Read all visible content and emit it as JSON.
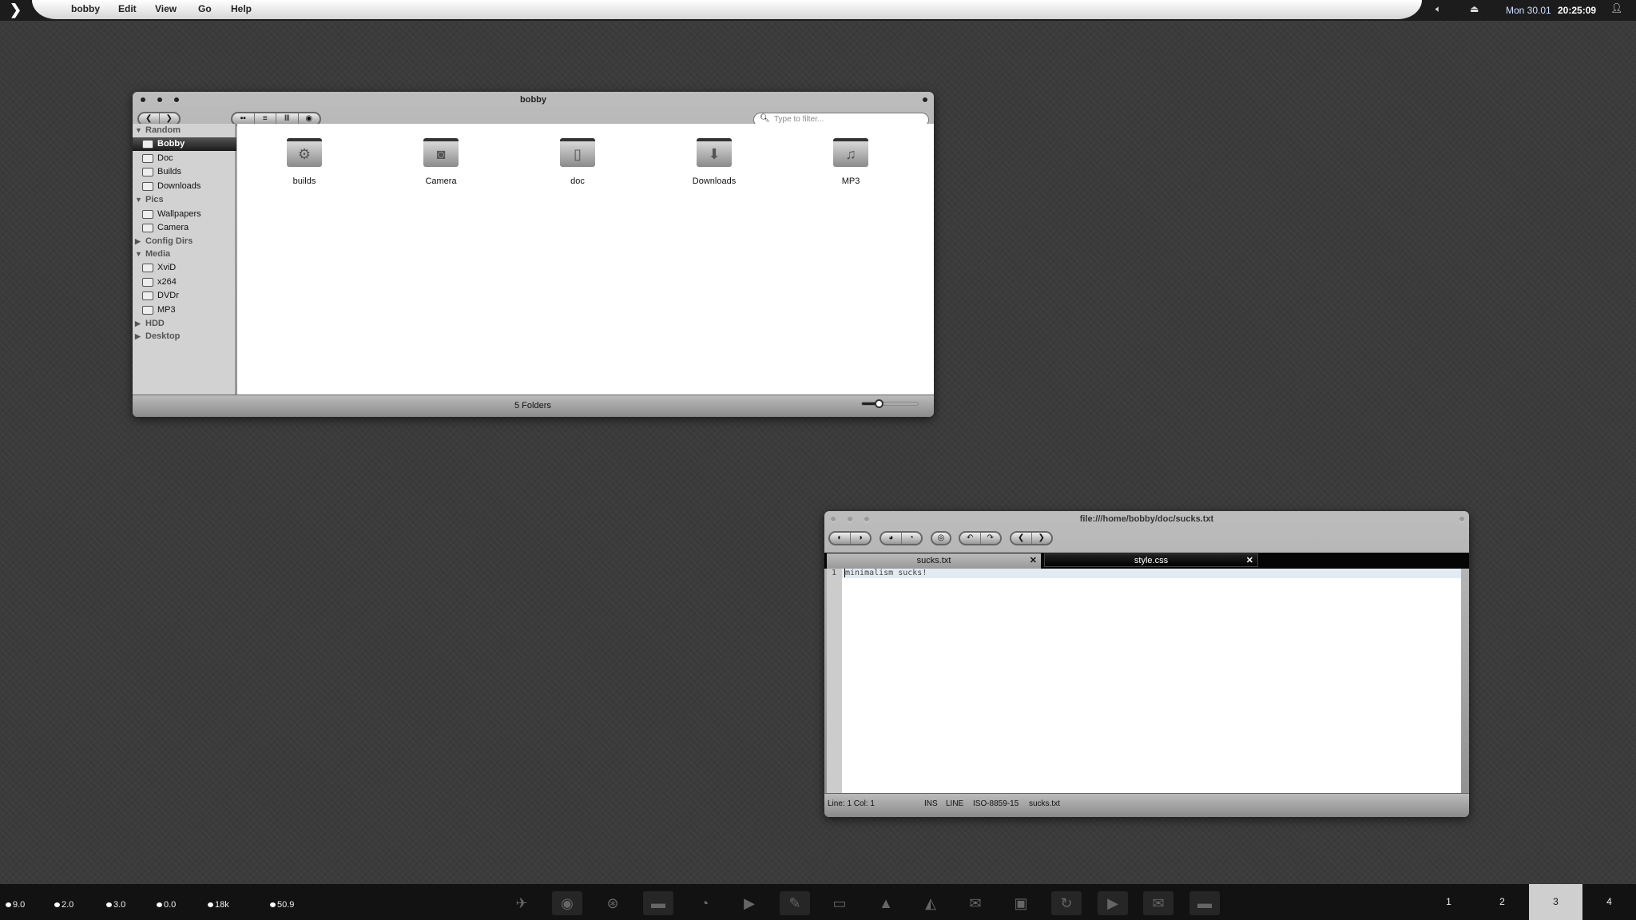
{
  "topbar": {
    "menus": [
      "bobby",
      "Edit",
      "View",
      "Go",
      "Help"
    ],
    "date": "Mon 30.01",
    "time": "20:25:09"
  },
  "filemanager": {
    "title": "bobby",
    "filter_placeholder": "Type to filter...",
    "status": "5 Folders",
    "zoom_level": 0.3,
    "sidebar": [
      {
        "label": "Random",
        "type": "header"
      },
      {
        "label": "Bobby",
        "type": "item",
        "selected": true
      },
      {
        "label": "Doc",
        "type": "item"
      },
      {
        "label": "Builds",
        "type": "item"
      },
      {
        "label": "Downloads",
        "type": "item"
      },
      {
        "label": "Pics",
        "type": "header"
      },
      {
        "label": "Wallpapers",
        "type": "item"
      },
      {
        "label": "Camera",
        "type": "item"
      },
      {
        "label": "Config Dirs",
        "type": "header",
        "collapsed": true
      },
      {
        "label": "Media",
        "type": "header"
      },
      {
        "label": "XviD",
        "type": "item"
      },
      {
        "label": "x264",
        "type": "item"
      },
      {
        "label": "DVDr",
        "type": "item"
      },
      {
        "label": "MP3",
        "type": "item"
      },
      {
        "label": "HDD",
        "type": "header",
        "collapsed": true
      },
      {
        "label": "Desktop",
        "type": "header",
        "collapsed": true
      }
    ],
    "folders": [
      {
        "label": "builds",
        "icon": "gear-icon"
      },
      {
        "label": "Camera",
        "icon": "camera-icon"
      },
      {
        "label": "doc",
        "icon": "document-icon"
      },
      {
        "label": "Downloads",
        "icon": "download-icon"
      },
      {
        "label": "MP3",
        "icon": "music-icon"
      }
    ]
  },
  "editor": {
    "title": "file:///home/bobby/doc/sucks.txt",
    "tabs": [
      {
        "label": "sucks.txt",
        "active": true
      },
      {
        "label": "style.css",
        "active": false
      }
    ],
    "lines": [
      {
        "num": "1",
        "text": "minimalism sucks!"
      }
    ],
    "status": {
      "position": "Line: 1 Col: 1",
      "mode": "INS",
      "select": "LINE",
      "encoding": "ISO-8859-15",
      "file": "sucks.txt"
    }
  },
  "bottombar": {
    "meters": [
      "9.0",
      "2.0",
      "3.0",
      "0.0",
      "18k",
      "50.9"
    ],
    "dock": [
      "bird-icon",
      "firefox-icon",
      "network-icon",
      "folder-icon",
      "pidgin-icon",
      "play-icon",
      "editor-icon",
      "chat-icon",
      "vlc-icon",
      "inkscape-icon",
      "thunderbird-icon",
      "terminal-icon",
      "sync-icon",
      "play-icon",
      "thunderbird-icon",
      "folder-icon"
    ],
    "workspaces": [
      "1",
      "2",
      "3",
      "4"
    ],
    "active_workspace": "3"
  }
}
